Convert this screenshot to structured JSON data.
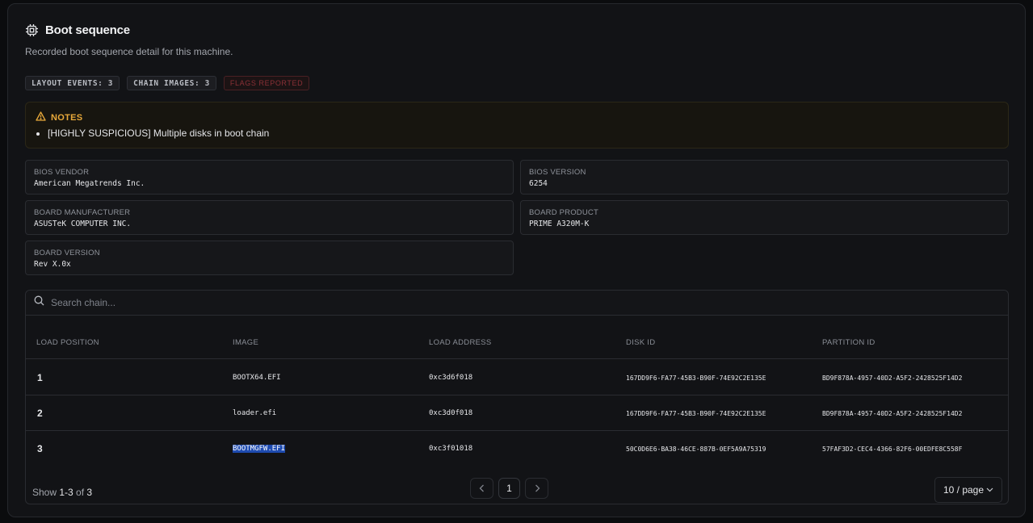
{
  "header": {
    "icon": "cpu-chip-icon",
    "title": "Boot sequence",
    "subtitle": "Recorded boot sequence detail for this machine."
  },
  "badges": {
    "layout_events": "LAYOUT EVENTS: 3",
    "chain_images": "CHAIN IMAGES: 3",
    "flags": "FLAGS REPORTED"
  },
  "notes": {
    "icon": "warning-triangle-icon",
    "title": "NOTES",
    "items": [
      "[HIGHLY SUSPICIOUS] Multiple disks in boot chain"
    ],
    "accent_color": "#e8a93a"
  },
  "info": {
    "bios_vendor": {
      "label": "BIOS VENDOR",
      "value": "American Megatrends Inc."
    },
    "bios_version": {
      "label": "BIOS VERSION",
      "value": "6254"
    },
    "board_manufacturer": {
      "label": "BOARD MANUFACTURER",
      "value": "ASUSTeK COMPUTER INC."
    },
    "board_product": {
      "label": "BOARD PRODUCT",
      "value": "PRIME A320M-K"
    },
    "board_version": {
      "label": "BOARD VERSION",
      "value": "Rev X.0x"
    }
  },
  "table": {
    "search_placeholder": "Search chain...",
    "columns": [
      "LOAD POSITION",
      "IMAGE",
      "LOAD ADDRESS",
      "DISK ID",
      "PARTITION ID"
    ],
    "rows": [
      {
        "position": "1",
        "image": "BOOTX64.EFI",
        "load_address": "0xc3d6f018",
        "disk_id": "167DD9F6-FA77-45B3-B90F-74E92C2E135E",
        "partition_id": "BD9F878A-4957-40D2-A5F2-2428525F14D2"
      },
      {
        "position": "2",
        "image": "loader.efi",
        "load_address": "0xc3d0f018",
        "disk_id": "167DD9F6-FA77-45B3-B90F-74E92C2E135E",
        "partition_id": "BD9F878A-4957-40D2-A5F2-2428525F14D2"
      },
      {
        "position": "3",
        "image": "BOOTMGFW.EFI",
        "load_address": "0xc3f01018",
        "disk_id": "50C0D6E6-BA38-46CE-887B-0EF5A9A75319",
        "partition_id": "57FAF3D2-CEC4-4366-82F6-00EDFE8C558F"
      }
    ]
  },
  "footer": {
    "show_prefix": "Show ",
    "range": "1-3",
    "of": " of ",
    "total": "3",
    "current_page": "1",
    "page_size": "10 / page"
  }
}
